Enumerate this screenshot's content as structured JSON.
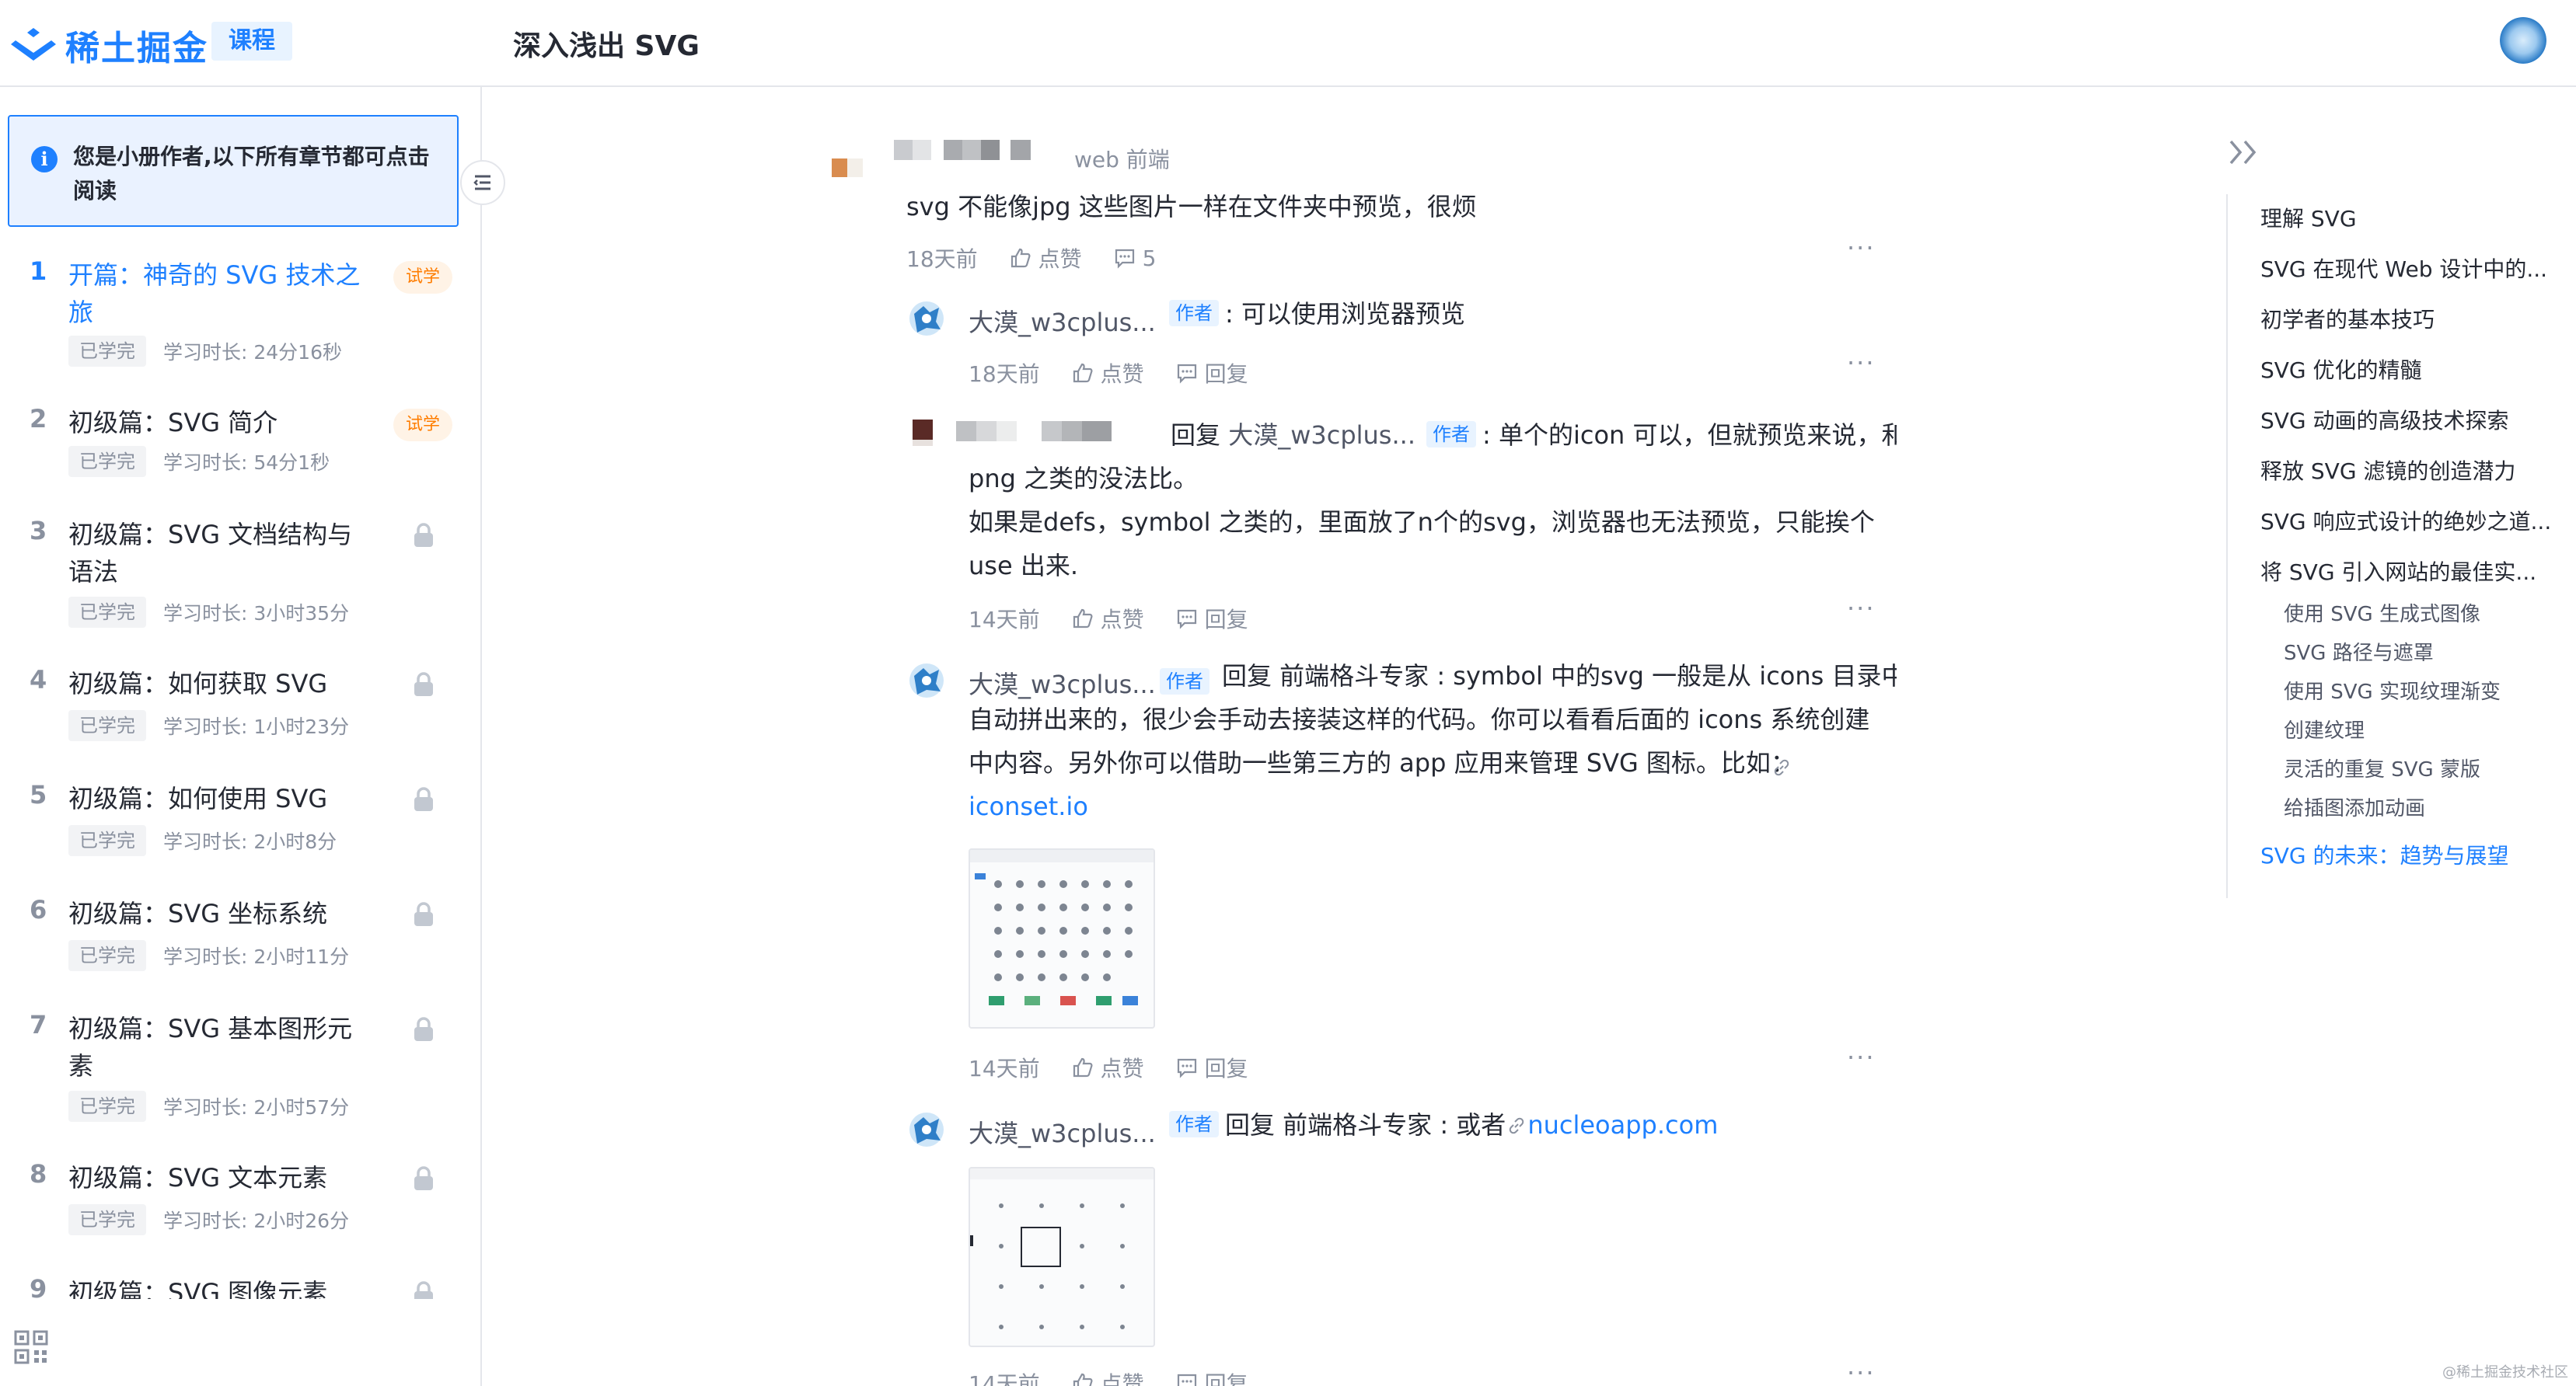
{
  "header": {
    "logo_text": "稀土掘金",
    "course_tag": "课程",
    "page_title": "深入浅出 SVG"
  },
  "sidebar": {
    "notice": "您是小册作者,以下所有章节都可点击阅读",
    "chapters": [
      {
        "num": "1",
        "title": "开篇：神奇的 SVG 技术之旅",
        "status": "已学完",
        "time": "学习时长: 24分16秒",
        "badge": "试学",
        "active": true
      },
      {
        "num": "2",
        "title": "初级篇：SVG 简介",
        "status": "已学完",
        "time": "学习时长: 54分1秒",
        "badge": "试学"
      },
      {
        "num": "3",
        "title": "初级篇：SVG 文档结构与语法",
        "status": "已学完",
        "time": "学习时长: 3小时35分"
      },
      {
        "num": "4",
        "title": "初级篇：如何获取 SVG",
        "status": "已学完",
        "time": "学习时长: 1小时23分"
      },
      {
        "num": "5",
        "title": "初级篇：如何使用 SVG",
        "status": "已学完",
        "time": "学习时长: 2小时8分"
      },
      {
        "num": "6",
        "title": "初级篇：SVG 坐标系统",
        "status": "已学完",
        "time": "学习时长: 2小时11分"
      },
      {
        "num": "7",
        "title": "初级篇：SVG 基本图形元素",
        "status": "已学完",
        "time": "学习时长: 2小时57分"
      },
      {
        "num": "8",
        "title": "初级篇：SVG 文本元素",
        "status": "已学完",
        "time": "学习时长: 2小时26分"
      },
      {
        "num": "9",
        "title": "初级篇：SVG 图像元素",
        "status": "",
        "time": ""
      }
    ]
  },
  "comments": {
    "c1": {
      "job": "web 前端",
      "text": "svg 不能像jpg 这些图片一样在文件夹中预览，很烦",
      "time": "18天前",
      "like": "点赞",
      "count": "5"
    },
    "r1": {
      "name": "大漠_w3cplus...",
      "badge": "作者",
      "text": ": 可以使用浏览器预览",
      "time": "18天前",
      "like": "点赞",
      "reply": "回复"
    },
    "r2": {
      "reply_word": "回复",
      "to": "大漠_w3cplus...",
      "badge": "作者",
      "line1": ": 单个的icon 可以，但就预览来说，和",
      "line2": "png 之类的没法比。",
      "line3": "如果是defs，symbol 之类的，里面放了n个的svg，浏览器也无法预览，只能挨个",
      "line4": "use 出来.",
      "time": "14天前",
      "like": "点赞",
      "reply": "回复"
    },
    "r3": {
      "name": "大漠_w3cplus...",
      "badge": "作者",
      "line1": "回复 前端格斗专家 : symbol 中的svg 一般是从 icons 目录中",
      "line2": "自动拼出来的，很少会手动去接装这样的代码。你可以看看后面的 icons 系统创建",
      "line3": "中内容。另外你可以借助一些第三方的 app 应用来管理 SVG 图标。比如：",
      "link": "iconset.io",
      "time": "14天前",
      "like": "点赞",
      "reply": "回复"
    },
    "r4": {
      "name": "大漠_w3cplus...",
      "badge": "作者",
      "text": "回复 前端格斗专家 : 或者",
      "link": "nucleoapp.com",
      "time": "14天前",
      "like": "点赞",
      "reply": "回复"
    }
  },
  "toc": {
    "items": [
      {
        "label": "理解 SVG"
      },
      {
        "label": "SVG 在现代 Web 设计中的..."
      },
      {
        "label": "初学者的基本技巧"
      },
      {
        "label": "SVG 优化的精髓"
      },
      {
        "label": "SVG 动画的高级技术探索"
      },
      {
        "label": "释放 SVG 滤镜的创造潜力"
      },
      {
        "label": "SVG 响应式设计的绝妙之道..."
      },
      {
        "label": "将 SVG 引入网站的最佳实..."
      }
    ],
    "subitems": [
      {
        "label": "使用 SVG 生成式图像"
      },
      {
        "label": "SVG 路径与遮罩"
      },
      {
        "label": "使用 SVG 实现纹理渐变"
      },
      {
        "label": "创建纹理"
      },
      {
        "label": "灵活的重复 SVG 蒙版"
      },
      {
        "label": "给插图添加动画"
      }
    ],
    "active": "SVG 的未来：趋势与展望"
  },
  "watermark": "@稀土掘金技术社区",
  "colors": {
    "accent": "#1e80ff",
    "trial": "#ff7d00",
    "muted": "#8a919f"
  }
}
